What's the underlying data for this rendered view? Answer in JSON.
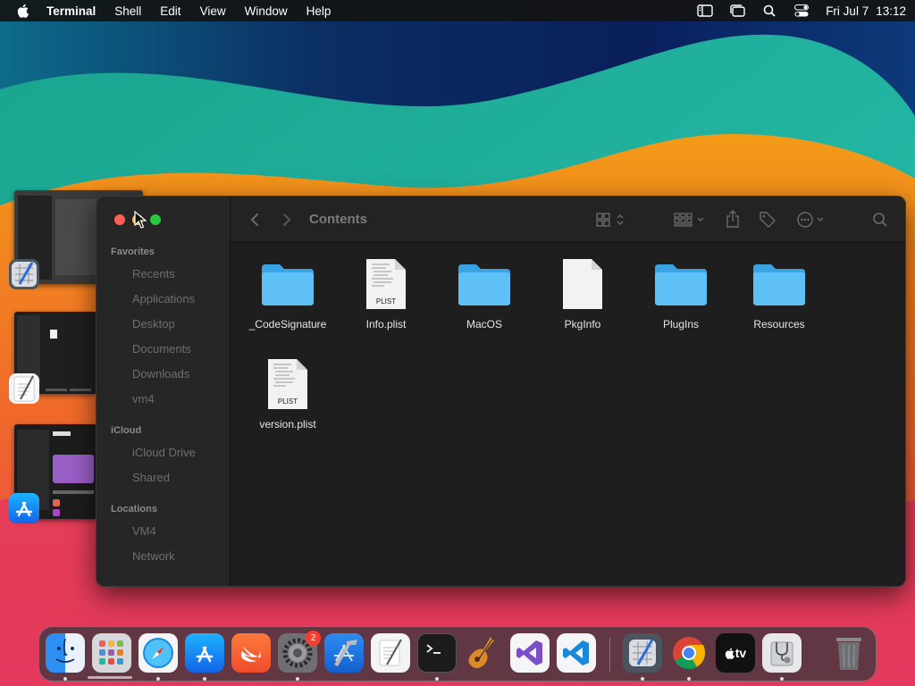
{
  "menubar": {
    "app_name": "Terminal",
    "menus": [
      "Shell",
      "Edit",
      "View",
      "Window",
      "Help"
    ],
    "date": "Fri Jul 7",
    "time": "13:12",
    "status_icons": [
      "sidebar-icon",
      "stage-manager-icon",
      "spotlight-search-icon",
      "control-center-icon"
    ]
  },
  "finder": {
    "title": "Contents",
    "sidebar": {
      "favorites_label": "Favorites",
      "favorites": [
        "Recents",
        "Applications",
        "Desktop",
        "Documents",
        "Downloads",
        "vm4"
      ],
      "icloud_label": "iCloud",
      "icloud": [
        "iCloud Drive",
        "Shared"
      ],
      "locations_label": "Locations",
      "locations": [
        "VM4",
        "Network"
      ]
    },
    "files": [
      {
        "name": "_CodeSignature",
        "kind": "folder"
      },
      {
        "name": "Info.plist",
        "kind": "plist",
        "badge": "PLIST"
      },
      {
        "name": "MacOS",
        "kind": "folder"
      },
      {
        "name": "PkgInfo",
        "kind": "document"
      },
      {
        "name": "PlugIns",
        "kind": "folder"
      },
      {
        "name": "Resources",
        "kind": "folder"
      },
      {
        "name": "version.plist",
        "kind": "plist",
        "badge": "PLIST"
      }
    ]
  },
  "stage_manager": [
    "Instruments",
    "TextEdit",
    "App Store"
  ],
  "dock": {
    "apps": [
      "Finder",
      "Launchpad",
      "Safari",
      "App Store",
      "Swift Playgrounds",
      "System Settings",
      "Xcode",
      "TextEdit",
      "Terminal",
      "GarageBand",
      "Visual Studio",
      "Visual Studio Code",
      "Instruments",
      "Google Chrome",
      "Apple TV",
      "Disk Utility",
      "Trash"
    ],
    "settings_badge": "2",
    "tv_label": "tv"
  },
  "colors": {
    "folder": "#4fb3f0",
    "close": "#ff5f57",
    "minimize": "#febc2e",
    "zoom": "#28c840"
  }
}
